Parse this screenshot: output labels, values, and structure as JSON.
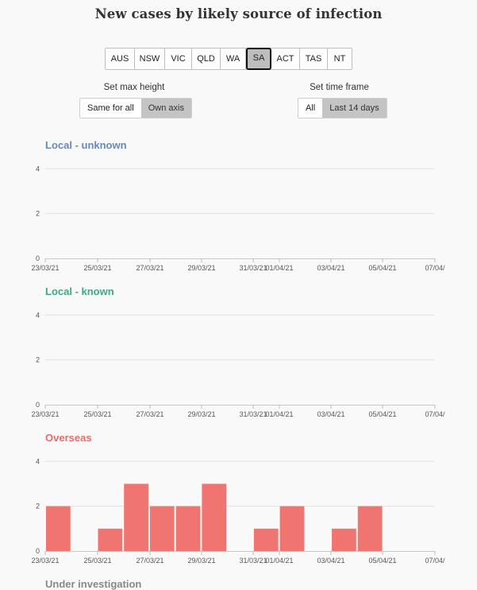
{
  "title": "New cases by likely source of infection",
  "regions": [
    "AUS",
    "NSW",
    "VIC",
    "QLD",
    "WA",
    "SA",
    "ACT",
    "TAS",
    "NT"
  ],
  "selected_region": "SA",
  "max_height": {
    "label": "Set max height",
    "options": [
      "Same for all",
      "Own axis"
    ],
    "selected": "Own axis"
  },
  "time_frame": {
    "label": "Set time frame",
    "options": [
      "All",
      "Last 14 days"
    ],
    "selected": "Last 14 days"
  },
  "chart_data": [
    {
      "type": "bar",
      "title": "Local - unknown",
      "color": "#6a88b8",
      "bar_color": "#f07470",
      "x_tick_labels": [
        "23/03/21",
        "25/03/21",
        "27/03/21",
        "29/03/21",
        "31/03/21",
        "01/04/21",
        "03/04/21",
        "05/04/21",
        "07/04/"
      ],
      "y_ticks": [
        0,
        2,
        4
      ],
      "ylim": [
        0,
        4.4
      ],
      "values": [
        0,
        0,
        0,
        0,
        0,
        0,
        0,
        0,
        0,
        0,
        0,
        0,
        0,
        0,
        0
      ]
    },
    {
      "type": "bar",
      "title": "Local - known",
      "color": "#3da88b",
      "bar_color": "#f07470",
      "x_tick_labels": [
        "23/03/21",
        "25/03/21",
        "27/03/21",
        "29/03/21",
        "31/03/21",
        "01/04/21",
        "03/04/21",
        "05/04/21",
        "07/04/"
      ],
      "y_ticks": [
        0,
        2,
        4
      ],
      "ylim": [
        0,
        4.4
      ],
      "values": [
        0,
        0,
        0,
        0,
        0,
        0,
        0,
        0,
        0,
        0,
        0,
        0,
        0,
        0,
        0
      ]
    },
    {
      "type": "bar",
      "title": "Overseas",
      "color": "#ea6a66",
      "bar_color": "#f07470",
      "x_tick_labels": [
        "23/03/21",
        "25/03/21",
        "27/03/21",
        "29/03/21",
        "31/03/21",
        "01/04/21",
        "03/04/21",
        "05/04/21",
        "07/04/"
      ],
      "y_ticks": [
        0,
        2,
        4
      ],
      "ylim": [
        0,
        4.4
      ],
      "dates": [
        "24/03/21",
        "25/03/21",
        "26/03/21",
        "27/03/21",
        "28/03/21",
        "29/03/21",
        "30/03/21",
        "31/03/21",
        "01/04/21",
        "02/04/21",
        "03/04/21",
        "04/04/21",
        "05/04/21",
        "06/04/21",
        "07/04/21"
      ],
      "values": [
        2,
        0,
        1,
        3,
        2,
        2,
        3,
        0,
        1,
        2,
        0,
        1,
        2,
        0,
        0
      ]
    }
  ],
  "next_chart_title": "Under investigation"
}
